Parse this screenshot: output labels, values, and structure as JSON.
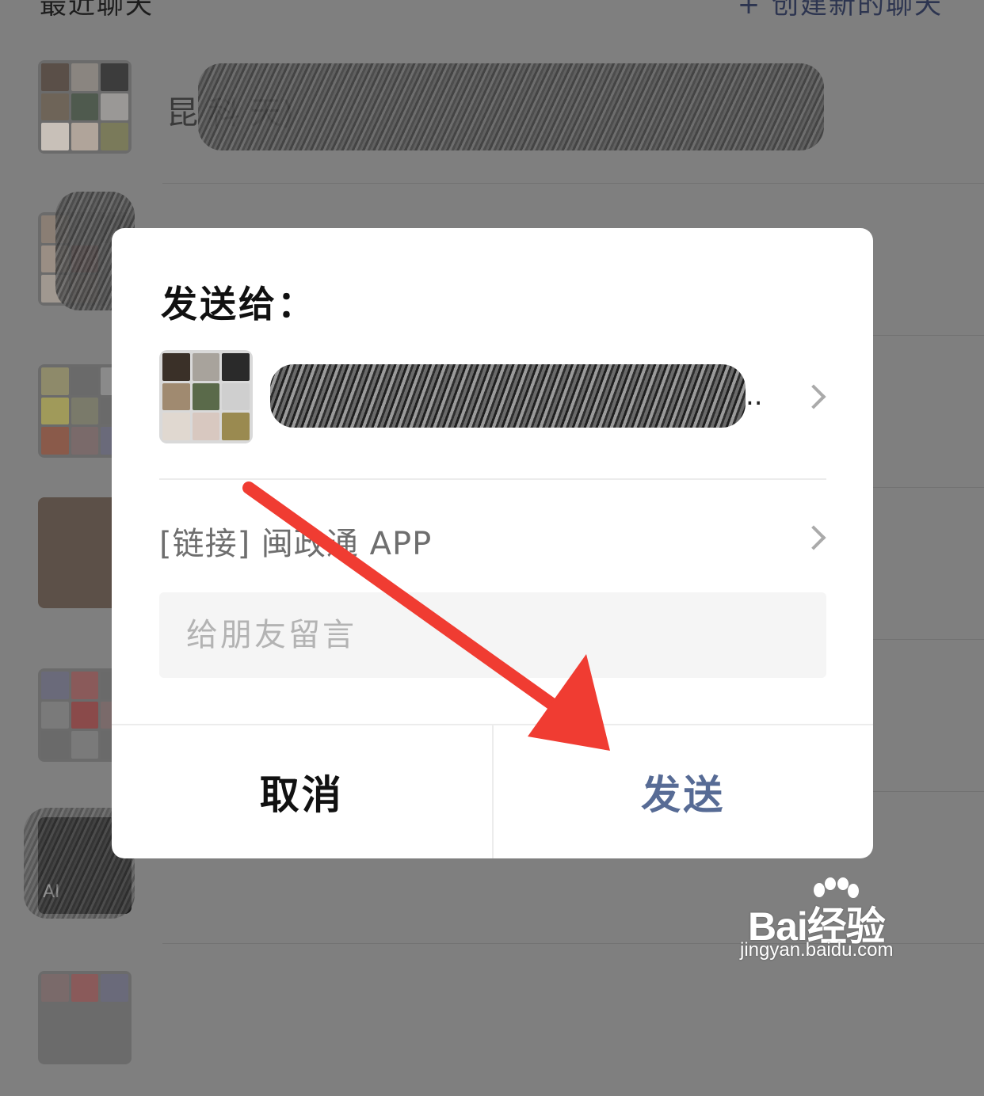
{
  "background": {
    "header_title": "最近聊天",
    "create_chat": "+ 创建新的聊天",
    "first_chat_name_visible": "昆                    科  天)",
    "row_name_partial": "AI"
  },
  "dialog": {
    "title": "发送给：",
    "recipient_ellipsis": "..",
    "link_label": "[链接] 闽政通 APP",
    "message_placeholder": "给朋友留言",
    "cancel_label": "取消",
    "send_label": "发送"
  },
  "watermark": {
    "brand": "Bai经验",
    "url": "jingyan.baidu.com"
  },
  "colors": {
    "send_accent": "#576b95",
    "arrow": "#f03c32",
    "overlay": "#7f7f7f"
  },
  "icons": [
    "chevron-right-icon",
    "annotation-arrow-icon",
    "baidu-paw-icon"
  ]
}
